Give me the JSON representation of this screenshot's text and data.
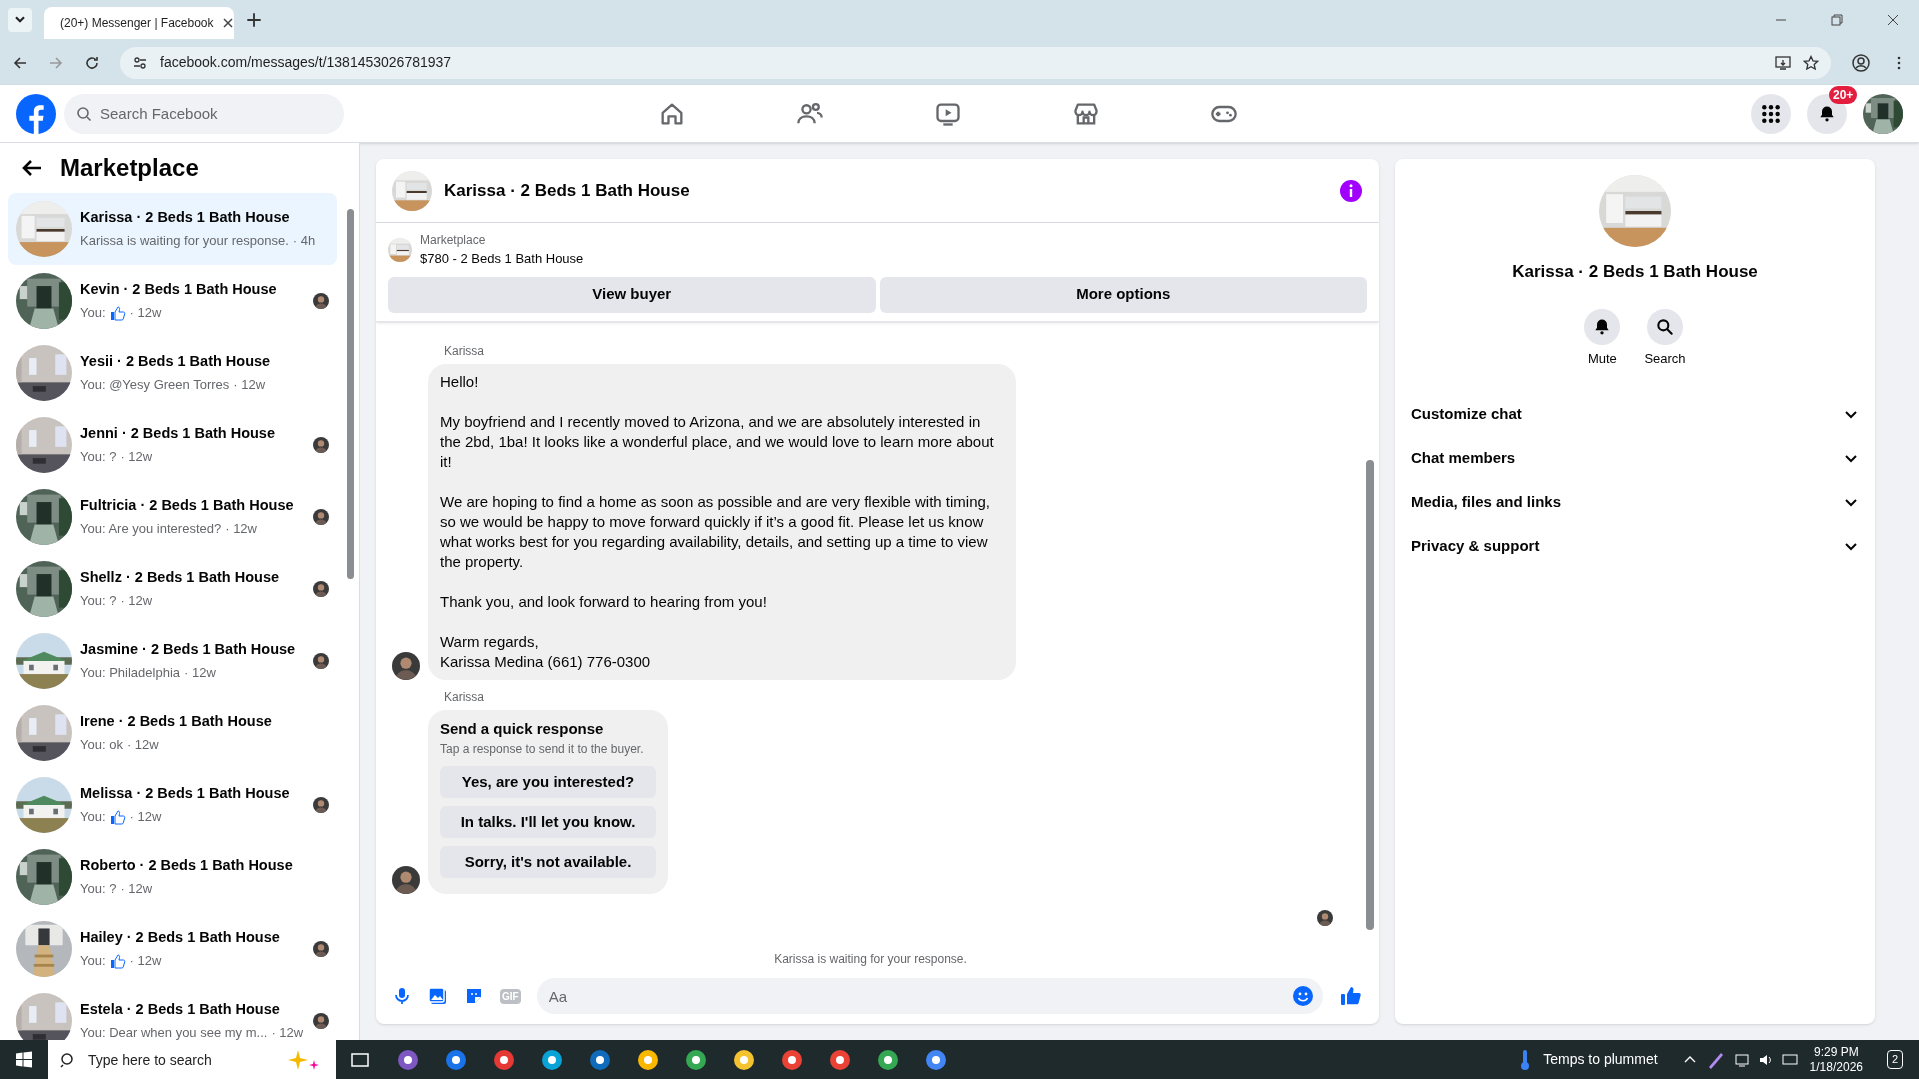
{
  "browser": {
    "tab_title": "(20+) Messenger | Facebook",
    "url": "facebook.com/messages/t/1381453026781937"
  },
  "header": {
    "search": {
      "placeholder": "Search Facebook"
    },
    "nav": [
      {
        "selected": false
      },
      {
        "selected": false
      },
      {
        "selected": false
      },
      {
        "selected": false
      },
      {
        "selected": false
      }
    ],
    "notification_badge": "20+"
  },
  "sidebar": {
    "title": "Marketplace",
    "conversations": [
      {
        "title": "Karissa · 2 Beds 1 Bath House",
        "preview": "Karissa is waiting for your response.",
        "time": "· 4h",
        "kind": "text",
        "seen": false,
        "selected": true
      },
      {
        "title": "Kevin · 2 Beds 1 Bath House",
        "preview": "You:",
        "time": "· 12w",
        "kind": "like",
        "seen": true,
        "selected": false
      },
      {
        "title": "Yesii · 2 Beds 1 Bath House",
        "preview": "You: @Yesy Green Torres",
        "time": "· 12w",
        "kind": "text",
        "seen": false,
        "selected": false
      },
      {
        "title": "Jenni · 2 Beds 1 Bath House",
        "preview": "You: ?",
        "time": "· 12w",
        "kind": "text",
        "seen": true,
        "selected": false
      },
      {
        "title": "Fultricia · 2 Beds 1 Bath House",
        "preview": "You: Are you interested?",
        "time": "· 12w",
        "kind": "text",
        "seen": true,
        "selected": false
      },
      {
        "title": "Shellz · 2 Beds 1 Bath House",
        "preview": "You: ?",
        "time": "· 12w",
        "kind": "text",
        "seen": true,
        "selected": false
      },
      {
        "title": "Jasmine · 2 Beds 1 Bath House",
        "preview": "You: Philadelphia",
        "time": "· 12w",
        "kind": "text",
        "seen": true,
        "selected": false
      },
      {
        "title": "Irene · 2 Beds 1 Bath House",
        "preview": "You: ok",
        "time": "· 12w",
        "kind": "text",
        "seen": false,
        "selected": false
      },
      {
        "title": "Melissa · 2 Beds 1 Bath House",
        "preview": "You:",
        "time": "· 12w",
        "kind": "like",
        "seen": true,
        "selected": false
      },
      {
        "title": "Roberto · 2 Beds 1 Bath House",
        "preview": "You: ?",
        "time": "· 12w",
        "kind": "text",
        "seen": false,
        "selected": false
      },
      {
        "title": "Hailey · 2 Beds 1 Bath House",
        "preview": "You:",
        "time": "· 12w",
        "kind": "like",
        "seen": true,
        "selected": false
      },
      {
        "title": "Estela · 2 Beds 1 Bath House",
        "preview": "You: Dear when you see my m...",
        "time": "· 12w",
        "kind": "text",
        "seen": true,
        "selected": false
      }
    ]
  },
  "chat": {
    "title": "Karissa · 2 Beds 1 Bath House",
    "listing": {
      "source": "Marketplace",
      "name": "$780 - 2 Beds 1 Bath House"
    },
    "buttons": [
      "View buyer",
      "More options"
    ],
    "messages": [
      {
        "kind": "text",
        "sender": "Karissa",
        "paragraphs": [
          "Hello!",
          "My boyfriend and I recently moved to Arizona, and we are absolutely interested in the 2bd, 1ba!  It looks like a wonderful place, and we would love to learn more about it!",
          "We are hoping to find a home as soon as possible and are very flexible with timing, so we would be happy to move forward quickly if it’s a good fit. Please let us know what works best for you regarding availability, details, and setting up a time to view the property.",
          "Thank you, and look forward to hearing from you!",
          "Warm regards,\nKarissa Medina (661) 776-0300"
        ]
      },
      {
        "kind": "quick",
        "sender": "Karissa",
        "heading": "Send a quick response",
        "subtext": "Tap a response to send it to the buyer.",
        "options": [
          "Yes, are you interested?",
          "In talks. I'll let you know.",
          "Sorry, it's not available."
        ]
      }
    ],
    "status": "Karissa is waiting for your response.",
    "composer": {
      "placeholder": "Aa",
      "gif_label": "GIF"
    }
  },
  "details": {
    "title": "Karissa · 2 Beds 1 Bath House",
    "actions": [
      {
        "label": "Mute"
      },
      {
        "label": "Search"
      }
    ],
    "sections": [
      {
        "label": "Customize chat",
        "expanded": false
      },
      {
        "label": "Chat members",
        "expanded": false
      },
      {
        "label": "Media, files and links",
        "expanded": false
      },
      {
        "label": "Privacy & support",
        "expanded": false
      }
    ]
  },
  "taskbar": {
    "search_placeholder": "Type here to search",
    "weather": "Temps to plummet",
    "time": "9:29 PM",
    "date": "1/18/2026",
    "notification_count": "2"
  }
}
